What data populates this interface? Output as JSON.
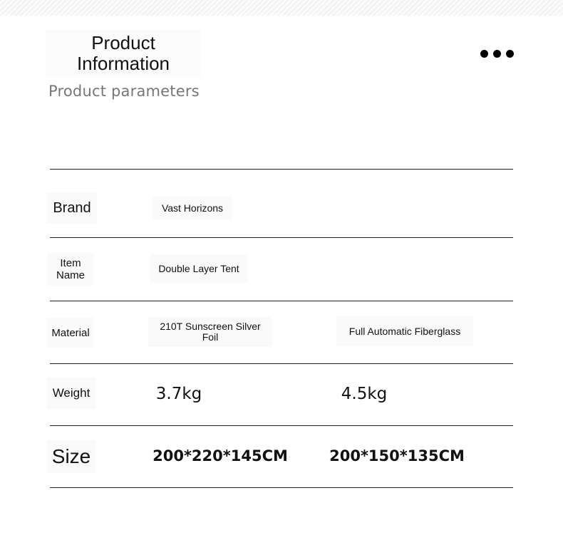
{
  "header": {
    "title_line1": "Product",
    "title_line2": "Information",
    "subtitle": "Product parameters",
    "menu_icon": "more-horizontal-icon"
  },
  "table": {
    "rows": [
      {
        "label": "Brand",
        "values": [
          "Vast Horizons"
        ]
      },
      {
        "label_line1": "Item",
        "label_line2": "Name",
        "values": [
          "Double Layer Tent"
        ]
      },
      {
        "label": "Material",
        "values": [
          "210T Sunscreen Silver Foil",
          "Full Automatic Fiberglass"
        ]
      },
      {
        "label": "Weight",
        "values": [
          "3.7kg",
          "4.5kg"
        ]
      },
      {
        "label": "Size",
        "values": [
          "200*220*145CM",
          "200*150*135CM"
        ]
      }
    ]
  }
}
